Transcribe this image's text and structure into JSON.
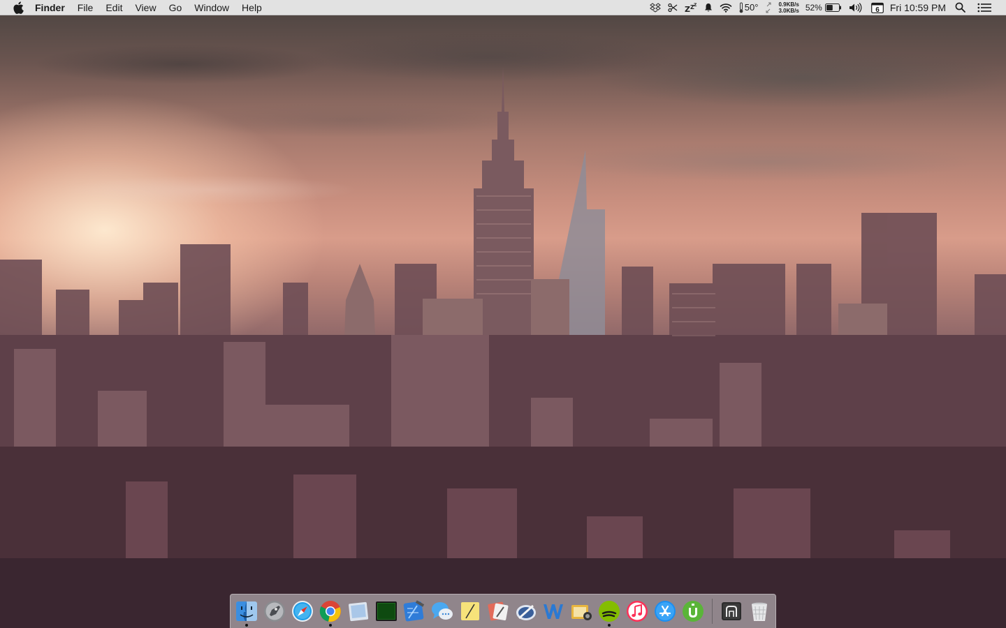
{
  "menubar": {
    "app_name": "Finder",
    "menus": [
      "File",
      "Edit",
      "View",
      "Go",
      "Window",
      "Help"
    ],
    "status": {
      "weather": "50°",
      "net_down": "0.9KB/s",
      "net_up": "3.0KB/s",
      "battery_percent": "52%",
      "battery_level": 0.52,
      "calendar_day": "6",
      "clock": "Fri 10:59 PM"
    }
  },
  "dock": {
    "apps": [
      {
        "name": "Finder",
        "icon": "finder-icon",
        "running": true
      },
      {
        "name": "Launchpad",
        "icon": "launchpad-icon",
        "running": false
      },
      {
        "name": "Safari",
        "icon": "safari-icon",
        "running": false
      },
      {
        "name": "Google Chrome",
        "icon": "chrome-icon",
        "running": true
      },
      {
        "name": "Preview",
        "icon": "preview-icon",
        "running": false
      },
      {
        "name": "Terminal",
        "icon": "terminal-icon",
        "running": false
      },
      {
        "name": "Xcode",
        "icon": "xcode-icon",
        "running": false
      },
      {
        "name": "Messages",
        "icon": "messages-icon",
        "running": false
      },
      {
        "name": "Notes",
        "icon": "notes-icon",
        "running": false
      },
      {
        "name": "Sketch",
        "icon": "sketch-icon",
        "running": false
      },
      {
        "name": "Photo Editor",
        "icon": "photo-editor-icon",
        "running": false
      },
      {
        "name": "Word",
        "icon": "word-icon",
        "running": false
      },
      {
        "name": "Image Capture",
        "icon": "image-capture-icon",
        "running": false
      },
      {
        "name": "Spotify",
        "icon": "spotify-icon",
        "running": true
      },
      {
        "name": "iTunes",
        "icon": "itunes-icon",
        "running": false
      },
      {
        "name": "App Store",
        "icon": "app-store-icon",
        "running": false
      },
      {
        "name": "uTorrent",
        "icon": "utorrent-icon",
        "running": false
      }
    ],
    "trailing": [
      {
        "name": "Downloads",
        "icon": "downloads-stack-icon"
      },
      {
        "name": "Trash",
        "icon": "trash-icon"
      }
    ]
  }
}
